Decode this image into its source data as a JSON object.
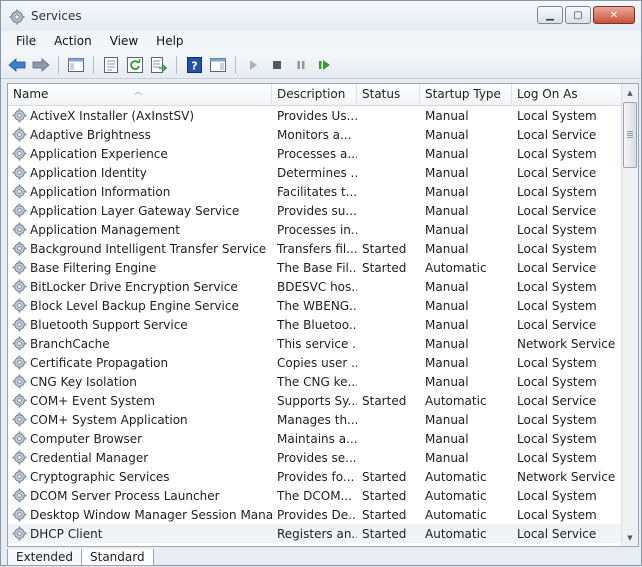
{
  "window": {
    "title": "Services"
  },
  "window_controls": {
    "minimize": "▁",
    "maximize": "▢",
    "close": "✕"
  },
  "menu": [
    "File",
    "Action",
    "View",
    "Help"
  ],
  "columns": [
    "Name",
    "Description",
    "Status",
    "Startup Type",
    "Log On As"
  ],
  "services": [
    {
      "name": "ActiveX Installer (AxInstSV)",
      "desc": "Provides Us...",
      "status": "",
      "startup": "Manual",
      "logon": "Local System"
    },
    {
      "name": "Adaptive Brightness",
      "desc": "Monitors a...",
      "status": "",
      "startup": "Manual",
      "logon": "Local Service"
    },
    {
      "name": "Application Experience",
      "desc": "Processes a...",
      "status": "",
      "startup": "Manual",
      "logon": "Local System"
    },
    {
      "name": "Application Identity",
      "desc": "Determines ...",
      "status": "",
      "startup": "Manual",
      "logon": "Local Service"
    },
    {
      "name": "Application Information",
      "desc": "Facilitates t...",
      "status": "",
      "startup": "Manual",
      "logon": "Local System"
    },
    {
      "name": "Application Layer Gateway Service",
      "desc": "Provides su...",
      "status": "",
      "startup": "Manual",
      "logon": "Local Service"
    },
    {
      "name": "Application Management",
      "desc": "Processes in...",
      "status": "",
      "startup": "Manual",
      "logon": "Local System"
    },
    {
      "name": "Background Intelligent Transfer Service",
      "desc": "Transfers fil...",
      "status": "Started",
      "startup": "Manual",
      "logon": "Local System"
    },
    {
      "name": "Base Filtering Engine",
      "desc": "The Base Fil...",
      "status": "Started",
      "startup": "Automatic",
      "logon": "Local Service"
    },
    {
      "name": "BitLocker Drive Encryption Service",
      "desc": "BDESVC hos...",
      "status": "",
      "startup": "Manual",
      "logon": "Local System"
    },
    {
      "name": "Block Level Backup Engine Service",
      "desc": "The WBENG...",
      "status": "",
      "startup": "Manual",
      "logon": "Local System"
    },
    {
      "name": "Bluetooth Support Service",
      "desc": "The Bluetoo...",
      "status": "",
      "startup": "Manual",
      "logon": "Local Service"
    },
    {
      "name": "BranchCache",
      "desc": "This service ...",
      "status": "",
      "startup": "Manual",
      "logon": "Network Service"
    },
    {
      "name": "Certificate Propagation",
      "desc": "Copies user ...",
      "status": "",
      "startup": "Manual",
      "logon": "Local System"
    },
    {
      "name": "CNG Key Isolation",
      "desc": "The CNG ke...",
      "status": "",
      "startup": "Manual",
      "logon": "Local System"
    },
    {
      "name": "COM+ Event System",
      "desc": "Supports Sy...",
      "status": "Started",
      "startup": "Automatic",
      "logon": "Local Service"
    },
    {
      "name": "COM+ System Application",
      "desc": "Manages th...",
      "status": "",
      "startup": "Manual",
      "logon": "Local System"
    },
    {
      "name": "Computer Browser",
      "desc": "Maintains a...",
      "status": "",
      "startup": "Manual",
      "logon": "Local System"
    },
    {
      "name": "Credential Manager",
      "desc": "Provides se...",
      "status": "",
      "startup": "Manual",
      "logon": "Local System"
    },
    {
      "name": "Cryptographic Services",
      "desc": "Provides fo...",
      "status": "Started",
      "startup": "Automatic",
      "logon": "Network Service"
    },
    {
      "name": "DCOM Server Process Launcher",
      "desc": "The DCOM...",
      "status": "Started",
      "startup": "Automatic",
      "logon": "Local System"
    },
    {
      "name": "Desktop Window Manager Session Manager",
      "desc": "Provides De...",
      "status": "Started",
      "startup": "Automatic",
      "logon": "Local System"
    },
    {
      "name": "DHCP Client",
      "desc": "Registers an...",
      "status": "Started",
      "startup": "Automatic",
      "logon": "Local Service"
    }
  ],
  "tabs": [
    "Extended",
    "Standard"
  ],
  "colors": {
    "accent": "#2f6fb8",
    "play": "#3a9a3a",
    "help": "#2452a8"
  }
}
